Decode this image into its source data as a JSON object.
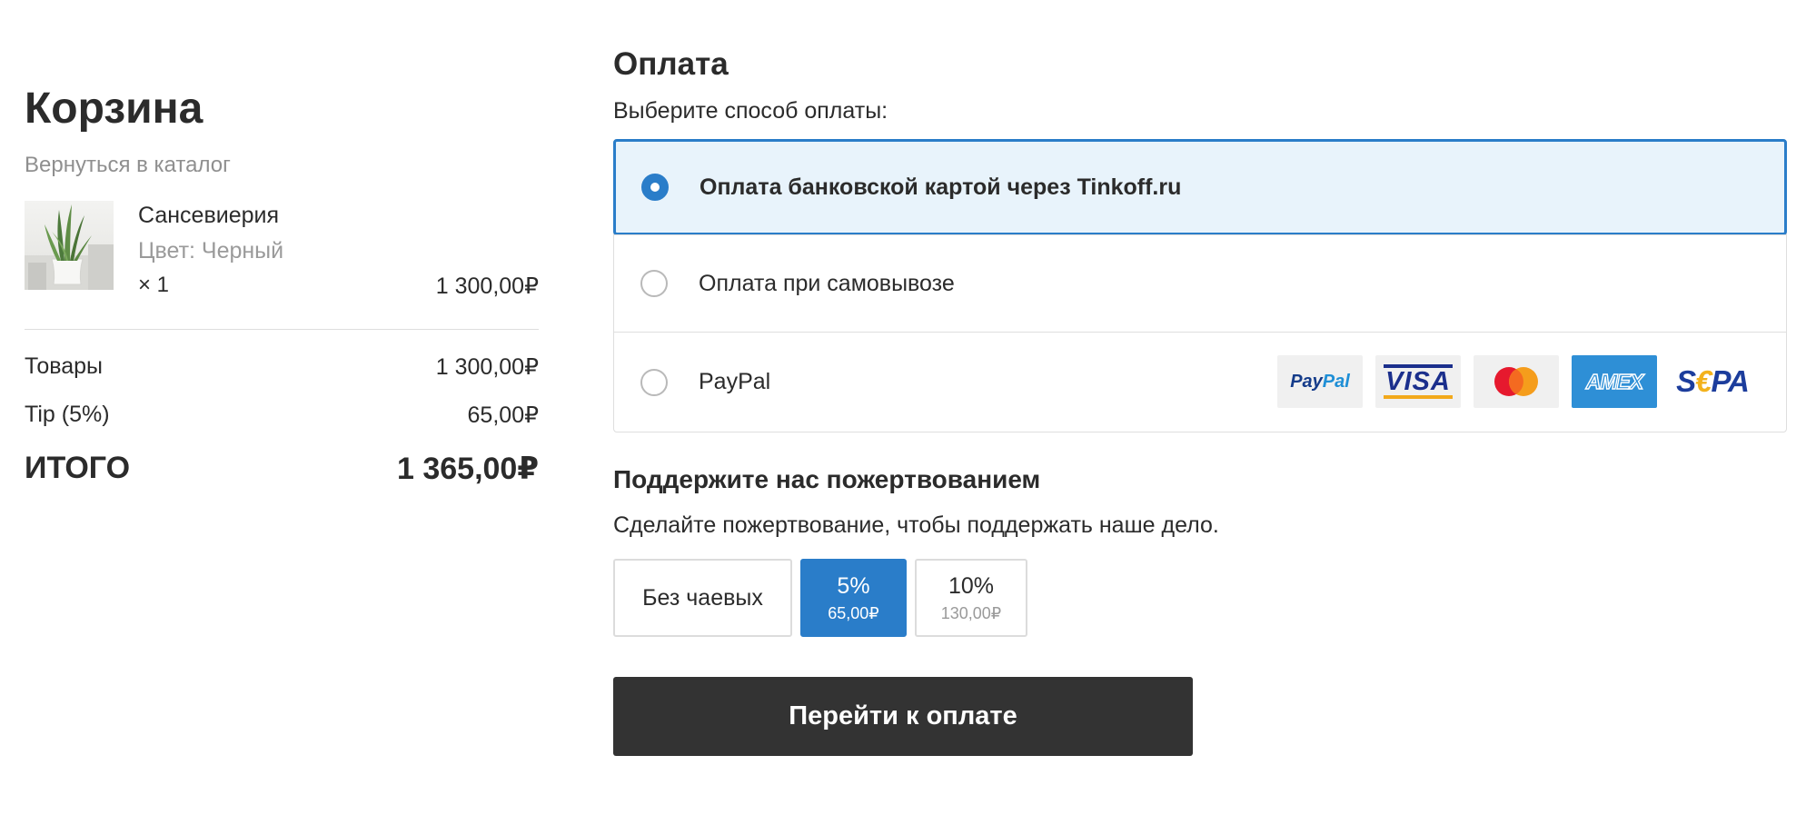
{
  "cart": {
    "title": "Корзина",
    "back_link": "Вернуться в каталог",
    "items": [
      {
        "name": "Сансевиерия",
        "variant": "Цвет: Черный",
        "quantity": "× 1",
        "price": "1 300,00₽",
        "thumbnail_icon": "plant-thumbnail-icon"
      }
    ],
    "summary": {
      "goods_label": "Товары",
      "goods_value": "1 300,00₽",
      "tip_label": "Tip (5%)",
      "tip_value": "65,00₽",
      "total_label": "ИТОГО",
      "total_value": "1 365,00₽"
    }
  },
  "payment": {
    "title": "Оплата",
    "subtitle": "Выберите способ оплаты:",
    "methods": [
      {
        "label": "Оплата банковской картой через Tinkoff.ru",
        "selected": true
      },
      {
        "label": "Оплата при самовывозе",
        "selected": false
      },
      {
        "label": "PayPal",
        "selected": false
      }
    ],
    "logos": {
      "paypal_pay": "Pay",
      "paypal_pal": "Pal",
      "visa": "VISA",
      "amex": "AMEX",
      "sepa_s": "S",
      "sepa_euro": "€",
      "sepa_pa": "PA"
    }
  },
  "donation": {
    "title": "Поддержите нас пожертвованием",
    "subtitle": "Сделайте пожертвование, чтобы поддержать наше дело.",
    "options": [
      {
        "label": "Без чаевых",
        "amount": "",
        "selected": false
      },
      {
        "label": "5%",
        "amount": "65,00₽",
        "selected": true
      },
      {
        "label": "10%",
        "amount": "130,00₽",
        "selected": false
      }
    ]
  },
  "checkout": {
    "button_label": "Перейти к оплате"
  },
  "colors": {
    "accent": "#2a7dc9",
    "selected_background": "#e8f3fb",
    "checkout_button": "#333333",
    "muted_text": "#9a9a9a"
  }
}
